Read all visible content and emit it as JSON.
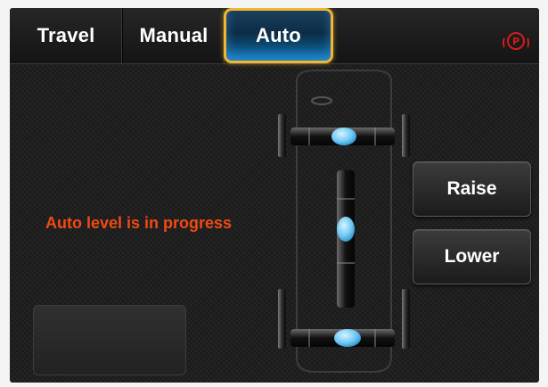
{
  "tabs": [
    {
      "label": "Travel",
      "selected": false
    },
    {
      "label": "Manual",
      "selected": false
    },
    {
      "label": "Auto",
      "selected": true
    }
  ],
  "park_icon": {
    "icon": "parking-brake-icon",
    "text": "P",
    "color": "#d41c1c"
  },
  "status_message": "Auto level is in progress",
  "buttons": {
    "raise": "Raise",
    "lower": "Lower"
  },
  "colors": {
    "accent": "#f2b631",
    "selected_tab": "#0a6da8",
    "status_text": "#f04a12",
    "jack_indicator": "#7fd4ff"
  },
  "diagram": {
    "icon": "vehicle-top-view-icon",
    "jacks": [
      "front-axle-jack",
      "center-jack",
      "rear-axle-jack"
    ]
  }
}
